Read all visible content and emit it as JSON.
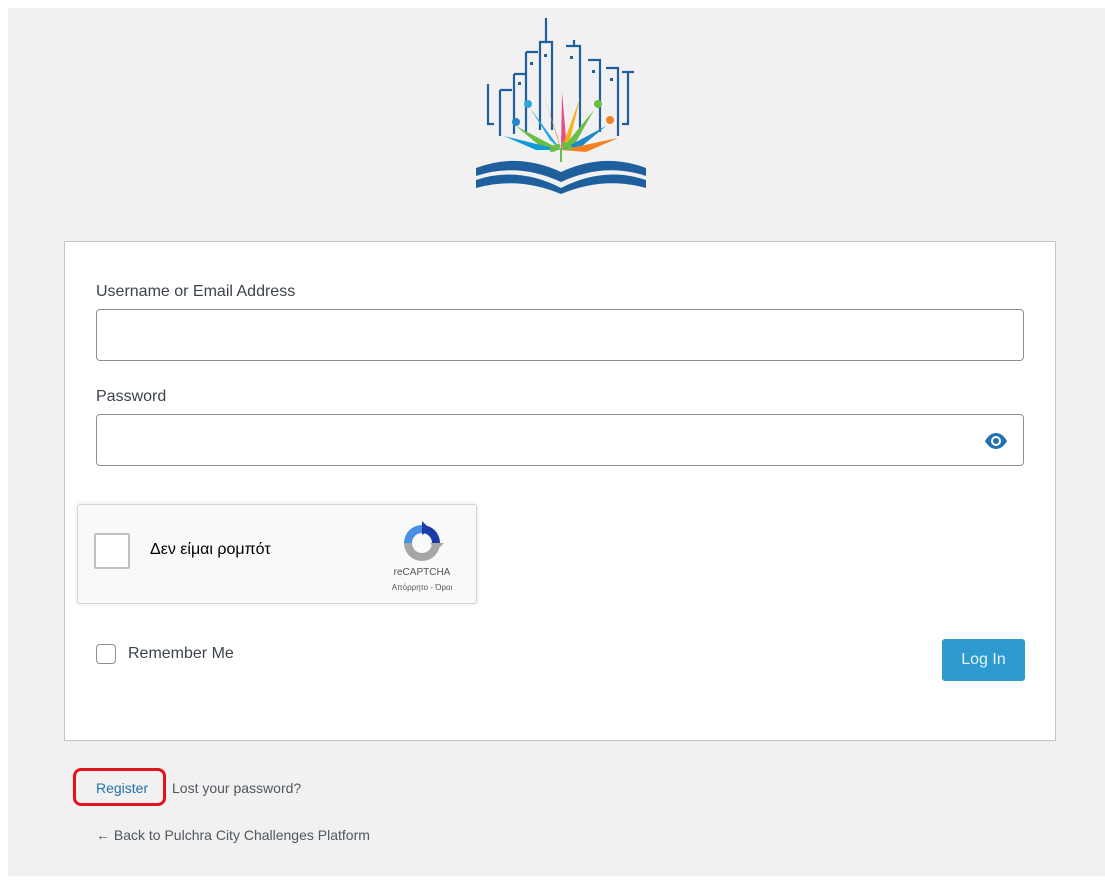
{
  "form": {
    "username_label": "Username or Email Address",
    "username_value": "",
    "password_label": "Password",
    "password_value": ""
  },
  "recaptcha": {
    "checkbox_label": "Δεν είμαι ρομπότ",
    "brand": "reCAPTCHA",
    "terms": "Απόρρητο - Όροι",
    "checked": false
  },
  "remember": {
    "label": "Remember Me",
    "checked": false
  },
  "login_button": {
    "label": "Log In"
  },
  "nav": {
    "register": "Register",
    "lost_password": "Lost your password?",
    "back": "← Back to Pulchra City Challenges Platform"
  },
  "icons": {
    "logo": "city-book-logo-icon",
    "password_toggle": "eye-icon",
    "recaptcha": "recaptcha-logo-icon"
  },
  "colors": {
    "background": "#f1f1f1",
    "link": "#2271b1",
    "button": "#2d9bd0",
    "highlight": "#e0141a"
  }
}
